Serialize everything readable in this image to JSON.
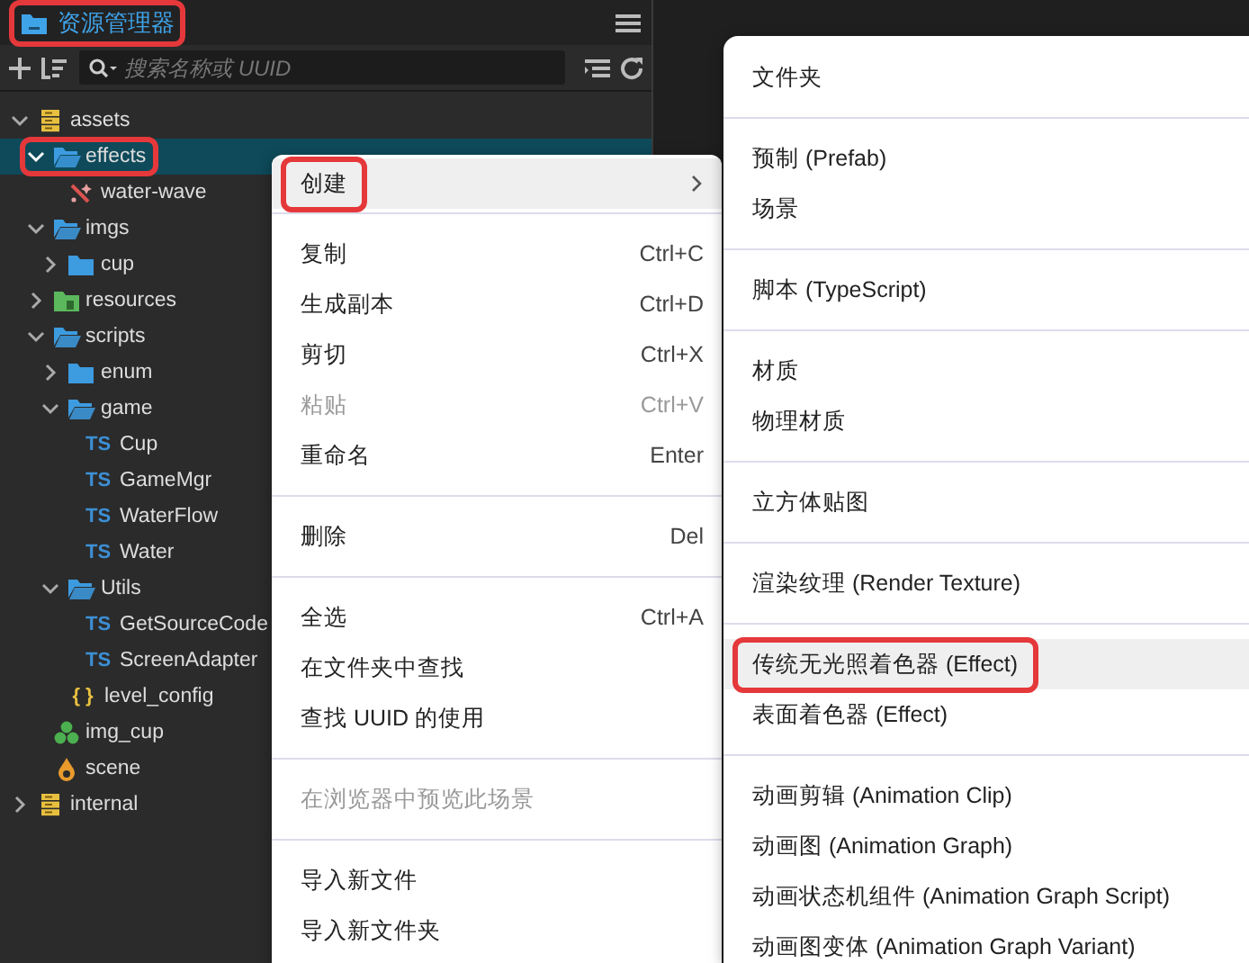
{
  "panel": {
    "title": "资源管理器",
    "title_highlighted": true,
    "search": {
      "placeholder": "搜索名称或 UUID"
    },
    "tree": [
      {
        "label": "assets",
        "kind": "db",
        "expanded": true,
        "selected": false,
        "highlighted": false,
        "children": [
          {
            "label": "effects",
            "kind": "folder",
            "expanded": true,
            "selected": true,
            "highlighted": true,
            "children": [
              {
                "label": "water-wave",
                "kind": "effect",
                "selected": false,
                "highlighted": false
              }
            ]
          },
          {
            "label": "imgs",
            "kind": "folder",
            "expanded": true,
            "selected": false,
            "highlighted": false,
            "children": [
              {
                "label": "cup",
                "kind": "folder",
                "expanded": false,
                "selected": false,
                "highlighted": false
              }
            ]
          },
          {
            "label": "resources",
            "kind": "bundle",
            "expanded": false,
            "selected": false,
            "highlighted": false
          },
          {
            "label": "scripts",
            "kind": "folder",
            "expanded": true,
            "selected": false,
            "highlighted": false,
            "children": [
              {
                "label": "enum",
                "kind": "folder",
                "expanded": false,
                "selected": false,
                "highlighted": false
              },
              {
                "label": "game",
                "kind": "folder",
                "expanded": true,
                "selected": false,
                "highlighted": false,
                "children": [
                  {
                    "label": "Cup",
                    "kind": "ts",
                    "badge": "TS",
                    "selected": false,
                    "highlighted": false
                  },
                  {
                    "label": "GameMgr",
                    "kind": "ts",
                    "badge": "TS",
                    "selected": false,
                    "highlighted": false
                  },
                  {
                    "label": "WaterFlow",
                    "kind": "ts",
                    "badge": "TS",
                    "selected": false,
                    "highlighted": false
                  },
                  {
                    "label": "Water",
                    "kind": "ts",
                    "badge": "TS",
                    "selected": false,
                    "highlighted": false
                  }
                ]
              },
              {
                "label": "Utils",
                "kind": "folder",
                "expanded": true,
                "selected": false,
                "highlighted": false,
                "children": [
                  {
                    "label": "GetSourceCode",
                    "kind": "ts",
                    "badge": "TS",
                    "selected": false,
                    "highlighted": false
                  },
                  {
                    "label": "ScreenAdapter",
                    "kind": "ts",
                    "badge": "TS",
                    "selected": false,
                    "highlighted": false
                  }
                ]
              },
              {
                "label": "level_config",
                "kind": "json",
                "badge": "{ }",
                "selected": false,
                "highlighted": false
              }
            ]
          },
          {
            "label": "img_cup",
            "kind": "prefab",
            "selected": false,
            "highlighted": false
          },
          {
            "label": "scene",
            "kind": "scene",
            "selected": false,
            "highlighted": false
          }
        ]
      },
      {
        "label": "internal",
        "kind": "db",
        "expanded": false,
        "selected": false,
        "highlighted": false
      }
    ]
  },
  "context_menu": {
    "groups": [
      [
        {
          "label": "创建",
          "has_submenu": true,
          "hovered": true,
          "highlighted": true,
          "disabled": false
        }
      ],
      [
        {
          "label": "复制",
          "shortcut": "Ctrl+C",
          "hovered": false,
          "highlighted": false,
          "disabled": false
        },
        {
          "label": "生成副本",
          "shortcut": "Ctrl+D",
          "hovered": false,
          "highlighted": false,
          "disabled": false
        },
        {
          "label": "剪切",
          "shortcut": "Ctrl+X",
          "hovered": false,
          "highlighted": false,
          "disabled": false
        },
        {
          "label": "粘贴",
          "shortcut": "Ctrl+V",
          "hovered": false,
          "highlighted": false,
          "disabled": true
        },
        {
          "label": "重命名",
          "shortcut": "Enter",
          "hovered": false,
          "highlighted": false,
          "disabled": false
        }
      ],
      [
        {
          "label": "删除",
          "shortcut": "Del",
          "hovered": false,
          "highlighted": false,
          "disabled": false
        }
      ],
      [
        {
          "label": "全选",
          "shortcut": "Ctrl+A",
          "hovered": false,
          "highlighted": false,
          "disabled": false
        },
        {
          "label": "在文件夹中查找",
          "hovered": false,
          "highlighted": false,
          "disabled": false
        },
        {
          "label": "查找 UUID 的使用",
          "hovered": false,
          "highlighted": false,
          "disabled": false
        }
      ],
      [
        {
          "label": "在浏览器中预览此场景",
          "hovered": false,
          "highlighted": false,
          "disabled": true
        }
      ],
      [
        {
          "label": "导入新文件",
          "hovered": false,
          "highlighted": false,
          "disabled": false
        },
        {
          "label": "导入新文件夹",
          "hovered": false,
          "highlighted": false,
          "disabled": false
        }
      ]
    ]
  },
  "submenu": {
    "groups": [
      [
        {
          "label": "文件夹",
          "hovered": false,
          "highlighted": false
        }
      ],
      [
        {
          "label": "预制 (Prefab)",
          "hovered": false,
          "highlighted": false
        },
        {
          "label": "场景",
          "hovered": false,
          "highlighted": false
        }
      ],
      [
        {
          "label": "脚本 (TypeScript)",
          "hovered": false,
          "highlighted": false
        }
      ],
      [
        {
          "label": "材质",
          "hovered": false,
          "highlighted": false
        },
        {
          "label": "物理材质",
          "hovered": false,
          "highlighted": false
        }
      ],
      [
        {
          "label": "立方体贴图",
          "hovered": false,
          "highlighted": false
        }
      ],
      [
        {
          "label": "渲染纹理 (Render Texture)",
          "hovered": false,
          "highlighted": false
        }
      ],
      [
        {
          "label": "传统无光照着色器 (Effect)",
          "hovered": true,
          "highlighted": true
        },
        {
          "label": "表面着色器 (Effect)",
          "hovered": false,
          "highlighted": false
        }
      ],
      [
        {
          "label": "动画剪辑 (Animation Clip)",
          "hovered": false,
          "highlighted": false
        },
        {
          "label": "动画图 (Animation Graph)",
          "hovered": false,
          "highlighted": false
        },
        {
          "label": "动画状态机组件 (Animation Graph Script)",
          "hovered": false,
          "highlighted": false
        },
        {
          "label": "动画图变体 (Animation Graph Variant)",
          "hovered": false,
          "highlighted": false
        }
      ]
    ]
  }
}
